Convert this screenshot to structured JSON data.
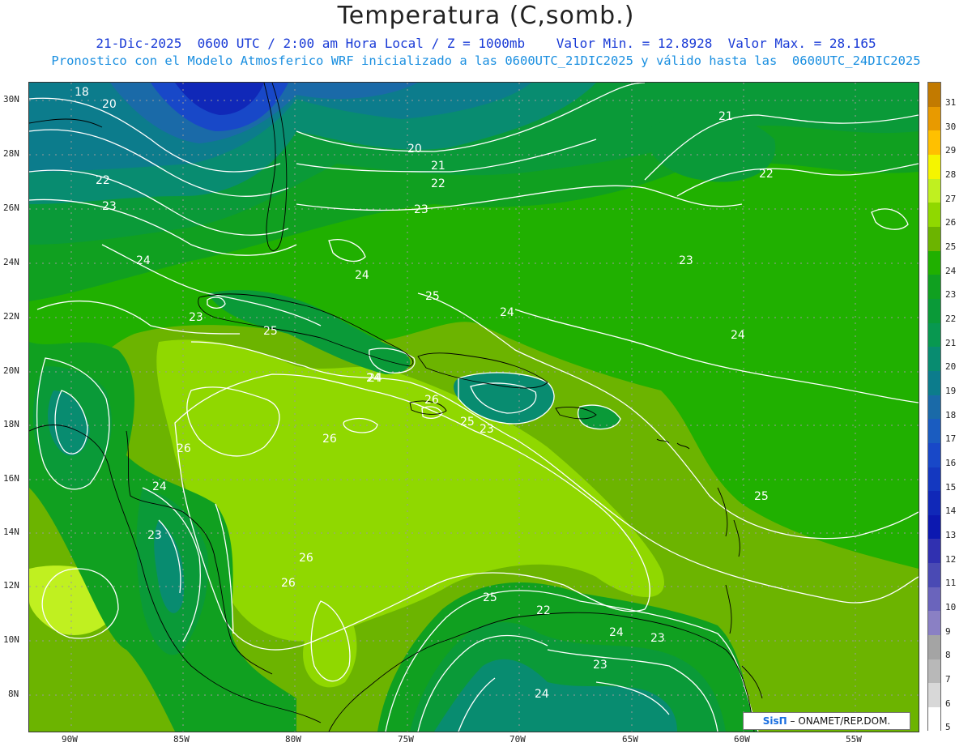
{
  "header": {
    "title": "Temperatura (C,somb.)",
    "line1": "21-Dic-2025  0600 UTC / 2:00 am Hora Local / Z = 1000mb    Valor Min. = 12.8928  Valor Max. = 28.165",
    "line2": "Pronostico con el Modelo Atmosferico WRF inicializado a las 0600UTC_21DIC2025 y válido hasta las  0600UTC_24DIC2025"
  },
  "axes": {
    "lat_labels": [
      "30N",
      "28N",
      "26N",
      "24N",
      "22N",
      "20N",
      "18N",
      "16N",
      "14N",
      "12N",
      "10N",
      "8N"
    ],
    "lon_labels": [
      "90W",
      "85W",
      "80W",
      "75W",
      "70W",
      "65W",
      "60W",
      "55W"
    ]
  },
  "colorbar": {
    "labels": [
      "31",
      "30",
      "29",
      "28",
      "27",
      "26",
      "25",
      "24",
      "23",
      "22",
      "21",
      "20",
      "19",
      "18",
      "17",
      "16",
      "15",
      "14",
      "13",
      "12",
      "11",
      "10",
      "9",
      "8",
      "7",
      "6",
      "5"
    ],
    "colors": [
      "#c27a00",
      "#e89a00",
      "#ffc000",
      "#f5f500",
      "#c0f020",
      "#90d800",
      "#6cb400",
      "#20b000",
      "#10a020",
      "#0a9a38",
      "#089850",
      "#088c70",
      "#0c7c8c",
      "#1a6aa8",
      "#1a5cc0",
      "#1848c8",
      "#1438c0",
      "#1028b8",
      "#0c18b0",
      "#3030b0",
      "#4a4ab4",
      "#6a64bc",
      "#8a80c4",
      "#a4a4a4",
      "#b8b8b8",
      "#d8d8d8",
      "#ffffff"
    ]
  },
  "contour_labels": [
    "18",
    "20",
    "22",
    "23",
    "24",
    "23",
    "25",
    "24",
    "26",
    "26",
    "24",
    "23",
    "26",
    "26",
    "20",
    "21",
    "22",
    "23",
    "24",
    "25",
    "24",
    "26",
    "25",
    "23",
    "24",
    "25",
    "22",
    "24",
    "23",
    "23",
    "24",
    "21",
    "22",
    "23",
    "24",
    "25"
  ],
  "credit": {
    "logo": "SisΠ",
    "text": "– ONAMET/REP.DOM."
  }
}
